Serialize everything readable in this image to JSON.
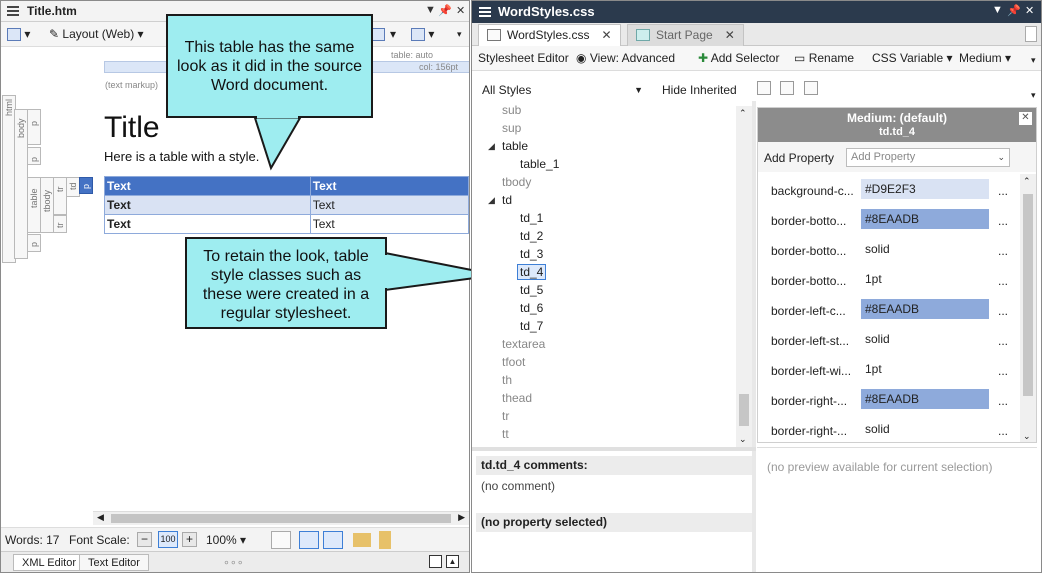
{
  "left_pane": {
    "title": "Title.htm",
    "layout_label": "Layout (Web)",
    "table_meta": "table: auto",
    "col_meta": "col: 156pt",
    "text_markup": "(text markup)",
    "structure_labels": [
      "html",
      "body",
      "p",
      "p",
      "table",
      "tbody",
      "tr",
      "td",
      "p",
      "tr",
      "p"
    ],
    "doc_title": "Title",
    "doc_para": "Here is a table with a style.",
    "table_rows": [
      [
        "Text",
        "Text"
      ],
      [
        "Text",
        "Text"
      ],
      [
        "Text",
        "Text"
      ]
    ],
    "status": {
      "words": "Words: 17",
      "font_scale": "Font Scale:",
      "zoom": "100%"
    },
    "bottom_tabs": [
      "XML Editor",
      "Text Editor"
    ]
  },
  "callouts": {
    "top": "This table has the same look as it did in the source Word document.",
    "bottom": "To retain the look, table style classes such as these were created in a regular stylesheet."
  },
  "right_pane": {
    "title": "WordStyles.css",
    "tabs": [
      "WordStyles.css",
      "Start Page"
    ],
    "toolbar": {
      "stylesheet_editor": "Stylesheet Editor",
      "view": "View: Advanced",
      "add_selector": "Add Selector",
      "rename": "Rename",
      "css_variable": "CSS Variable",
      "medium": "Medium"
    },
    "filter": "All Styles",
    "hide_inherited": "Hide Inherited",
    "tree": [
      {
        "label": "sub",
        "indent": 0,
        "muted": true
      },
      {
        "label": "sup",
        "indent": 0,
        "muted": true
      },
      {
        "label": "table",
        "indent": 0,
        "muted": false,
        "expanded": true
      },
      {
        "label": "table_1",
        "indent": 1,
        "muted": false
      },
      {
        "label": "tbody",
        "indent": 0,
        "muted": true
      },
      {
        "label": "td",
        "indent": 0,
        "muted": false,
        "expanded": true
      },
      {
        "label": "td_1",
        "indent": 1,
        "muted": false
      },
      {
        "label": "td_2",
        "indent": 1,
        "muted": false
      },
      {
        "label": "td_3",
        "indent": 1,
        "muted": false
      },
      {
        "label": "td_4",
        "indent": 1,
        "muted": false,
        "selected": true
      },
      {
        "label": "td_5",
        "indent": 1,
        "muted": false
      },
      {
        "label": "td_6",
        "indent": 1,
        "muted": false
      },
      {
        "label": "td_7",
        "indent": 1,
        "muted": false
      },
      {
        "label": "textarea",
        "indent": 0,
        "muted": true
      },
      {
        "label": "tfoot",
        "indent": 0,
        "muted": true
      },
      {
        "label": "th",
        "indent": 0,
        "muted": true
      },
      {
        "label": "thead",
        "indent": 0,
        "muted": true
      },
      {
        "label": "tr",
        "indent": 0,
        "muted": true
      },
      {
        "label": "tt",
        "indent": 0,
        "muted": true
      }
    ],
    "comments_header": "td.td_4 comments:",
    "comments_value": "(no comment)",
    "property_header": "(no property selected)",
    "property_panel": {
      "medium": "Medium: (default)",
      "selector": "td.td_4",
      "add_property_label": "Add Property",
      "add_property_placeholder": "Add Property",
      "properties": [
        {
          "name": "background-c...",
          "value": "#D9E2F3",
          "swatch": "#D9E2F3"
        },
        {
          "name": "border-botto...",
          "value": "#8EAADB",
          "swatch": "#8EAADB"
        },
        {
          "name": "border-botto...",
          "value": "solid",
          "swatch": ""
        },
        {
          "name": "border-botto...",
          "value": "1pt",
          "swatch": ""
        },
        {
          "name": "border-left-c...",
          "value": "#8EAADB",
          "swatch": "#8EAADB"
        },
        {
          "name": "border-left-st...",
          "value": "solid",
          "swatch": ""
        },
        {
          "name": "border-left-wi...",
          "value": "1pt",
          "swatch": ""
        },
        {
          "name": "border-right-...",
          "value": "#8EAADB",
          "swatch": "#8EAADB"
        },
        {
          "name": "border-right-...",
          "value": "solid",
          "swatch": ""
        }
      ],
      "more": "..."
    },
    "preview_text": "(no preview available for current selection)"
  }
}
